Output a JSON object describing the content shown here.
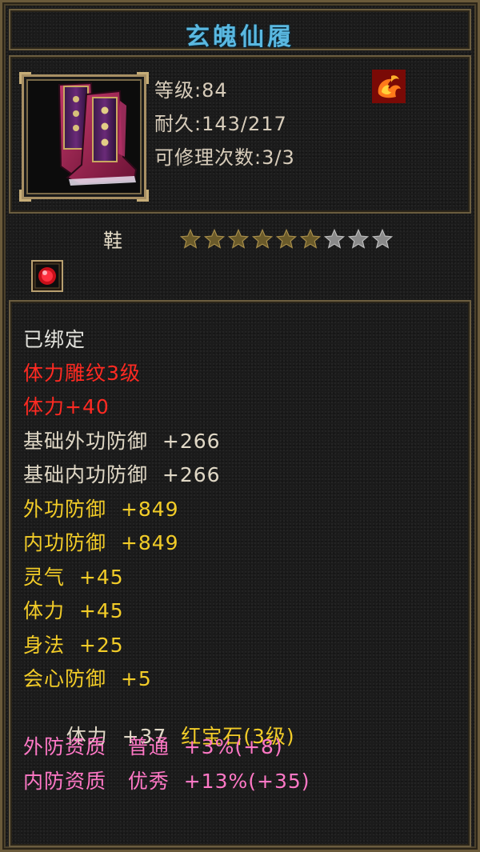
{
  "item": {
    "name": "玄魄仙履",
    "level_label": "等级:84",
    "durability_label": "耐久:143/217",
    "repair_label": "可修理次数:3/3",
    "type": "鞋",
    "stars_filled": 6,
    "stars_total": 9
  },
  "colors": {
    "title": "#5ab8e0",
    "bound": "#e2e2dc",
    "engrave": "#ff2a22",
    "base": "#e0d8c6",
    "bonus": "#f2cc28",
    "quality": "#ff78c6",
    "gem": "#f2cc28"
  },
  "icons": {
    "item": "boots-icon",
    "element": "fire-swirl-icon",
    "socket": "red-gem-icon",
    "star": "star-icon"
  },
  "attributes": {
    "bound": "已绑定",
    "engrave_title": "体力雕纹3级",
    "engrave_stat": "体力+40",
    "base_ext_def": "基础外功防御  +266",
    "base_int_def": "基础内功防御  +266",
    "ext_def": "外功防御  +849",
    "int_def": "内功防御  +849",
    "spirit": "灵气  +45",
    "stamina": "体力  +45",
    "agility": "身法  +25",
    "crit_def": "会心防御  +5",
    "gem_stat": "体力  +37",
    "gem_name": "红宝石(3级)",
    "ext_quality": "外防资质   普通  +3%(+8)",
    "int_quality": "内防资质   优秀  +13%(+35)"
  }
}
